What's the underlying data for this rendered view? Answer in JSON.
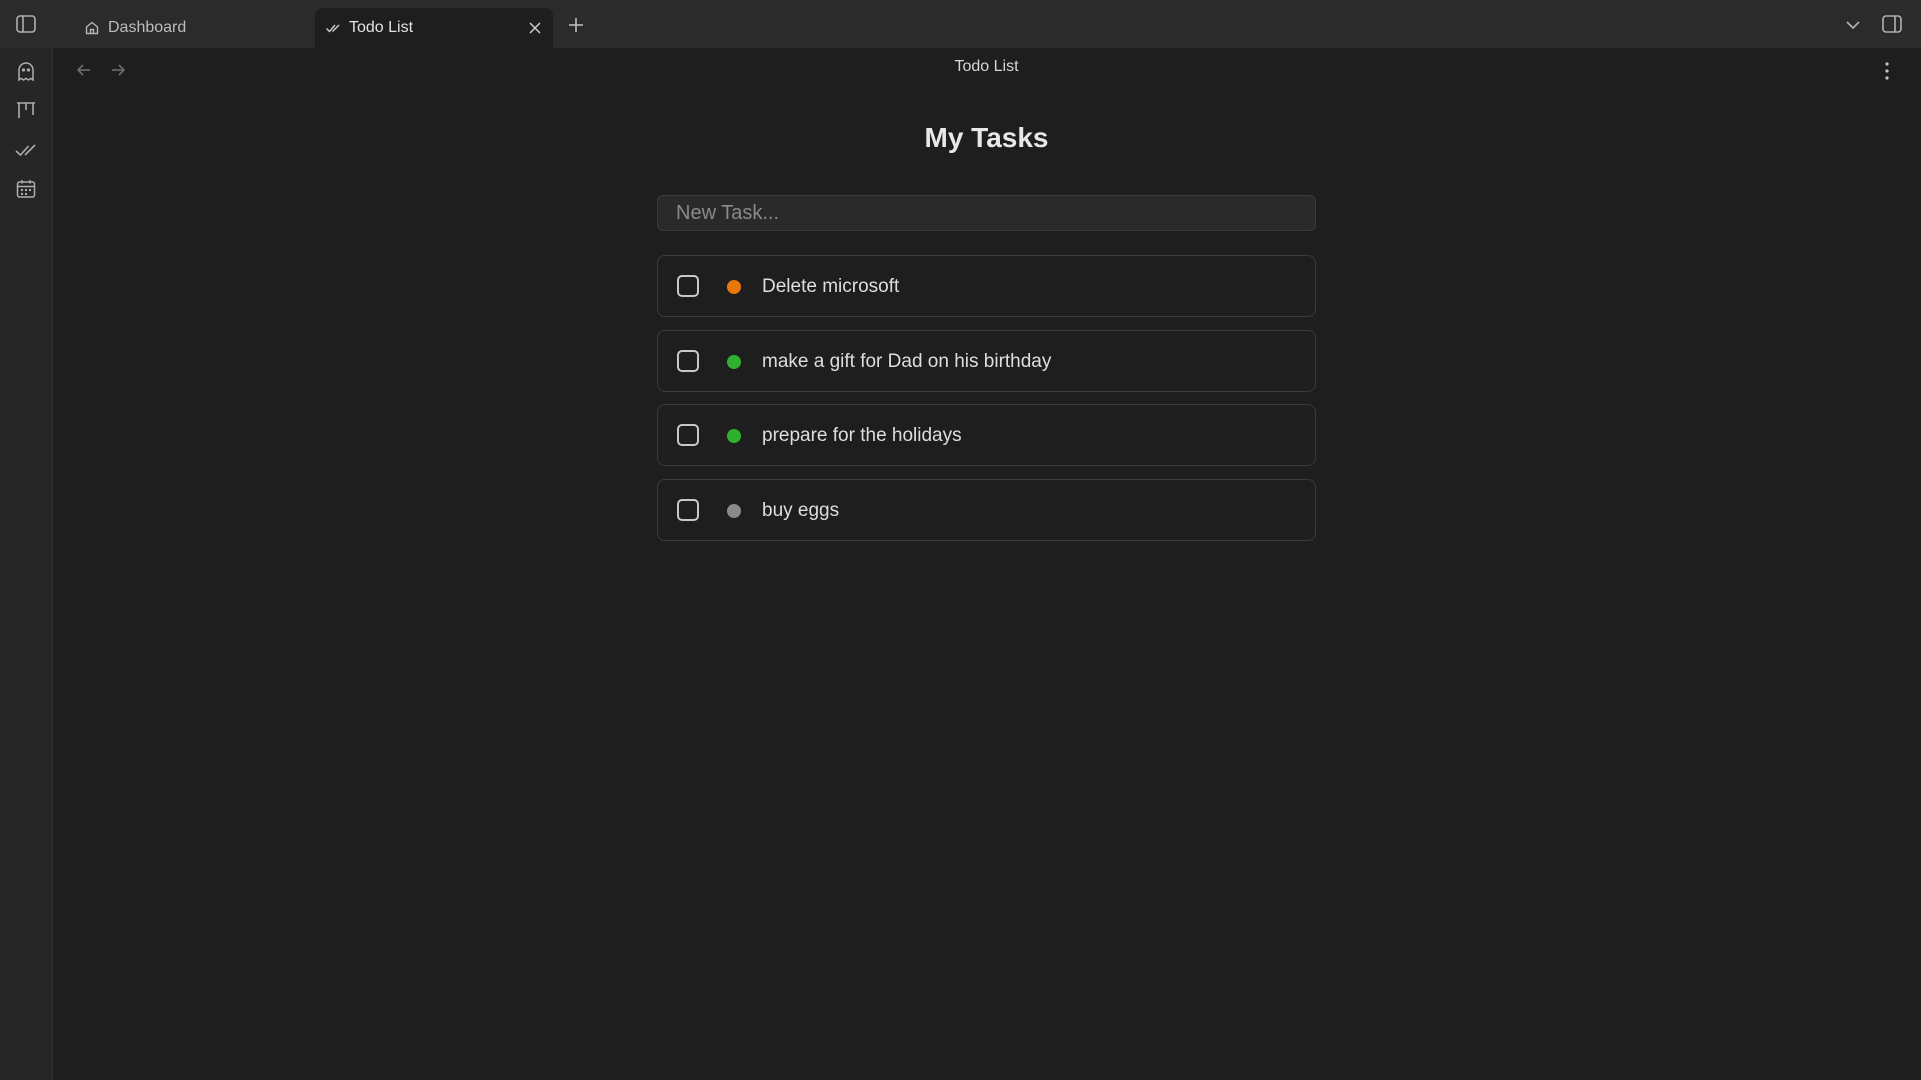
{
  "tabs": [
    {
      "label": "Dashboard",
      "icon": "home-icon",
      "active": false
    },
    {
      "label": "Todo List",
      "icon": "double-check-icon",
      "active": true
    }
  ],
  "view": {
    "title": "Todo List"
  },
  "main": {
    "heading": "My Tasks",
    "new_task_placeholder": "New Task...",
    "tasks": [
      {
        "label": "Delete microsoft",
        "priority_color": "#e8780c",
        "checked": false
      },
      {
        "label": "make a gift for Dad on his birthday",
        "priority_color": "#2fb12f",
        "checked": false
      },
      {
        "label": "prepare for the holidays",
        "priority_color": "#2fb12f",
        "checked": false
      },
      {
        "label": "buy eggs",
        "priority_color": "#8a8a8a",
        "checked": false
      }
    ]
  },
  "ribbon": {
    "items": [
      "ghost-icon",
      "kanban-icon",
      "double-check-icon",
      "calendar-icon"
    ]
  }
}
